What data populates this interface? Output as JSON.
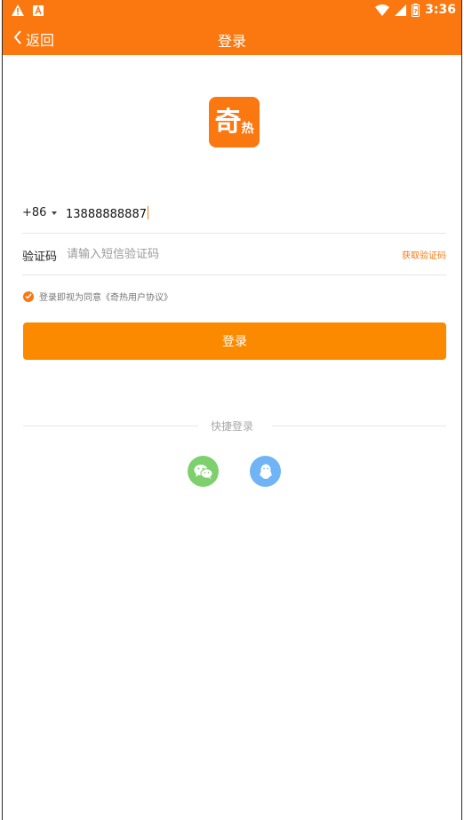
{
  "status_bar": {
    "time": "3:36",
    "icons": [
      "warning-icon",
      "a-icon",
      "wifi-icon",
      "cellular-icon",
      "battery-icon"
    ]
  },
  "header": {
    "back_label": "返回",
    "title": "登录",
    "bg_color": "#fb770f"
  },
  "logo": {
    "char_big": "奇",
    "char_small": "热"
  },
  "form": {
    "country_code": "+86",
    "phone_value": "13888888887",
    "code_label": "验证码",
    "code_placeholder": "请输入短信验证码",
    "get_code_label": "获取验证码",
    "agreement_text": "登录即视为同意《奇热用户协议》",
    "agreement_checked": true
  },
  "login_button": {
    "label": "登录",
    "color": "#fb8a00"
  },
  "quick_login": {
    "label": "快捷登录",
    "providers": [
      {
        "name": "wechat-icon",
        "color": "#7dd06c"
      },
      {
        "name": "qq-icon",
        "color": "#70b4f5"
      }
    ]
  }
}
